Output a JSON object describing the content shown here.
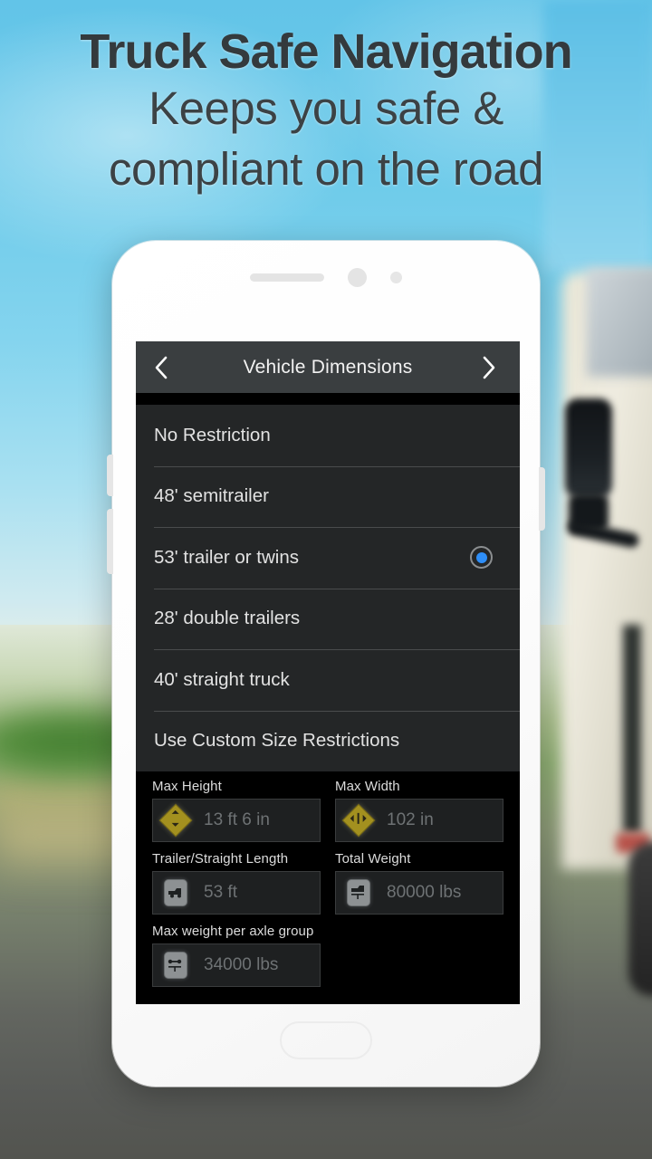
{
  "headline": {
    "line1": "Truck Safe Navigation",
    "line2": "Keeps you safe &",
    "line3": "compliant on the road"
  },
  "phone": {
    "speaker_icon": "speaker-grille",
    "camera_icon": "front-camera",
    "sensor_icon": "proximity-sensor",
    "home_button": "home-button"
  },
  "app": {
    "titlebar": {
      "back_icon": "chevron-left-icon",
      "title": "Vehicle Dimensions",
      "forward_icon": "chevron-right-icon"
    },
    "options": [
      {
        "label": "No Restriction",
        "selected": false
      },
      {
        "label": "48' semitrailer",
        "selected": false
      },
      {
        "label": "53' trailer or twins",
        "selected": true
      },
      {
        "label": "28' double trailers",
        "selected": false
      },
      {
        "label": "40' straight truck",
        "selected": false
      },
      {
        "label": "Use Custom Size Restrictions",
        "selected": false
      }
    ],
    "fields": [
      {
        "label": "Max Height",
        "value": "13 ft 6 in",
        "icon": "height-warning-diamond-icon"
      },
      {
        "label": "Max Width",
        "value": "102 in",
        "icon": "width-warning-diamond-icon"
      },
      {
        "label": "Trailer/Straight Length",
        "value": "53 ft",
        "icon": "truck-length-sign-icon"
      },
      {
        "label": "Total Weight",
        "value": "80000 lbs",
        "icon": "truck-weight-sign-icon"
      },
      {
        "label": "Max weight per axle group",
        "value": "34000 lbs",
        "icon": "axle-weight-sign-icon"
      }
    ]
  },
  "colors": {
    "accent_blue": "#2e8ef7",
    "titlebar": "#3a3e40",
    "list_bg": "#242627",
    "sky": "#62c4e8",
    "sign_yellow": "#a3901f"
  }
}
